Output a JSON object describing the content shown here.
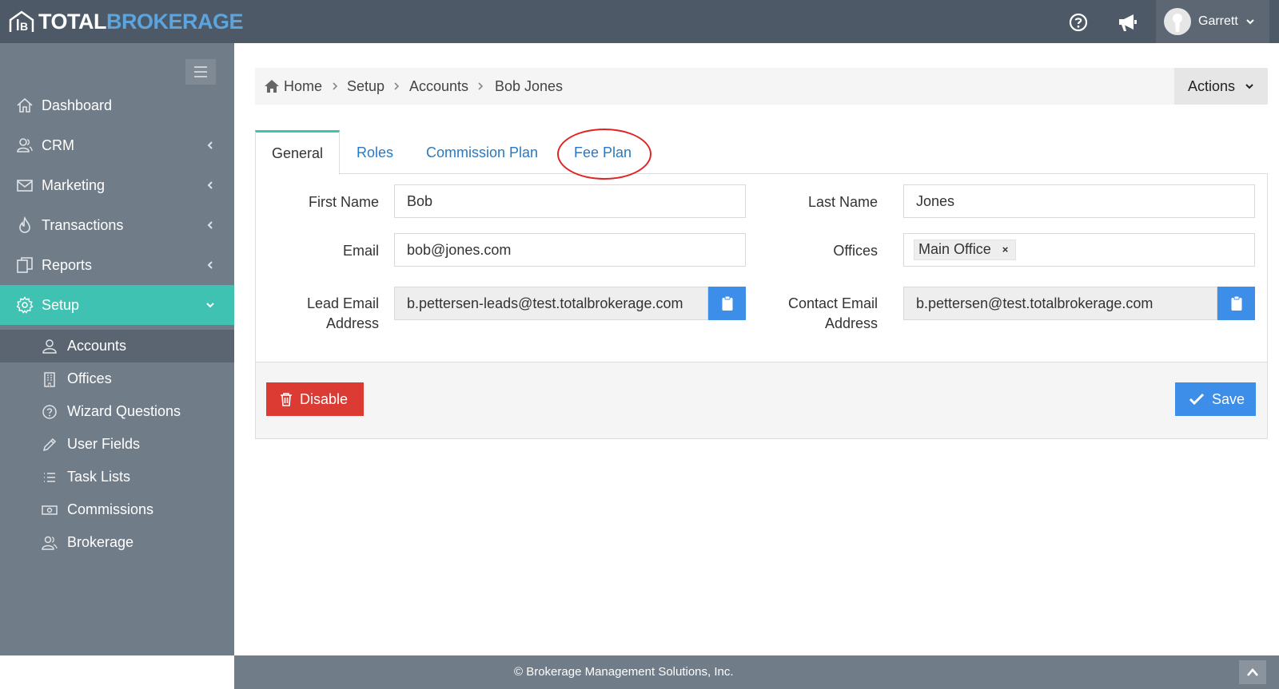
{
  "brand": {
    "total": "TOTAL",
    "brokerage": "BROKERAGE"
  },
  "topbar": {
    "user_name": "Garrett",
    "icons": [
      "help-icon",
      "megaphone-icon",
      "chevron-down-icon"
    ]
  },
  "sidebar": {
    "items": [
      {
        "label": "Dashboard",
        "icon": "home-icon"
      },
      {
        "label": "CRM",
        "icon": "users-icon"
      },
      {
        "label": "Marketing",
        "icon": "envelope-icon"
      },
      {
        "label": "Transactions",
        "icon": "flame-icon"
      },
      {
        "label": "Reports",
        "icon": "copy-icon"
      },
      {
        "label": "Setup",
        "icon": "gear-icon"
      }
    ],
    "subitems": [
      {
        "label": "Accounts",
        "icon": "user-icon"
      },
      {
        "label": "Offices",
        "icon": "building-icon"
      },
      {
        "label": "Wizard Questions",
        "icon": "question-icon"
      },
      {
        "label": "User Fields",
        "icon": "pencil-icon"
      },
      {
        "label": "Task Lists",
        "icon": "list-icon"
      },
      {
        "label": "Commissions",
        "icon": "money-icon"
      },
      {
        "label": "Brokerage",
        "icon": "users-icon"
      }
    ]
  },
  "breadcrumb": [
    "Home",
    "Setup",
    "Accounts",
    "Bob Jones"
  ],
  "actions_label": "Actions",
  "tabs": [
    "General",
    "Roles",
    "Commission Plan",
    "Fee Plan"
  ],
  "form": {
    "first_name_label": "First Name",
    "first_name_value": "Bob",
    "last_name_label": "Last Name",
    "last_name_value": "Jones",
    "email_label": "Email",
    "email_value": "bob@jones.com",
    "offices_label": "Offices",
    "offices_tag": "Main Office",
    "offices_tag_remove": "×",
    "lead_email_label_1": "Lead Email",
    "lead_email_label_2": "Address",
    "lead_email_value": "b.pettersen-leads@test.totalbrokerage.com",
    "contact_email_label_1": "Contact Email",
    "contact_email_label_2": "Address",
    "contact_email_value": "b.pettersen@test.totalbrokerage.com"
  },
  "buttons": {
    "disable": "Disable",
    "save": "Save"
  },
  "footer": "© Brokerage Management Solutions, Inc.",
  "colors": {
    "topbar": "#4d5966",
    "sidebar": "#707c88",
    "accent": "#3fc2b2",
    "primary": "#3d8ee8",
    "danger": "#dc3b34",
    "link": "#2a79c0",
    "highlight_circle": "#e02424"
  }
}
